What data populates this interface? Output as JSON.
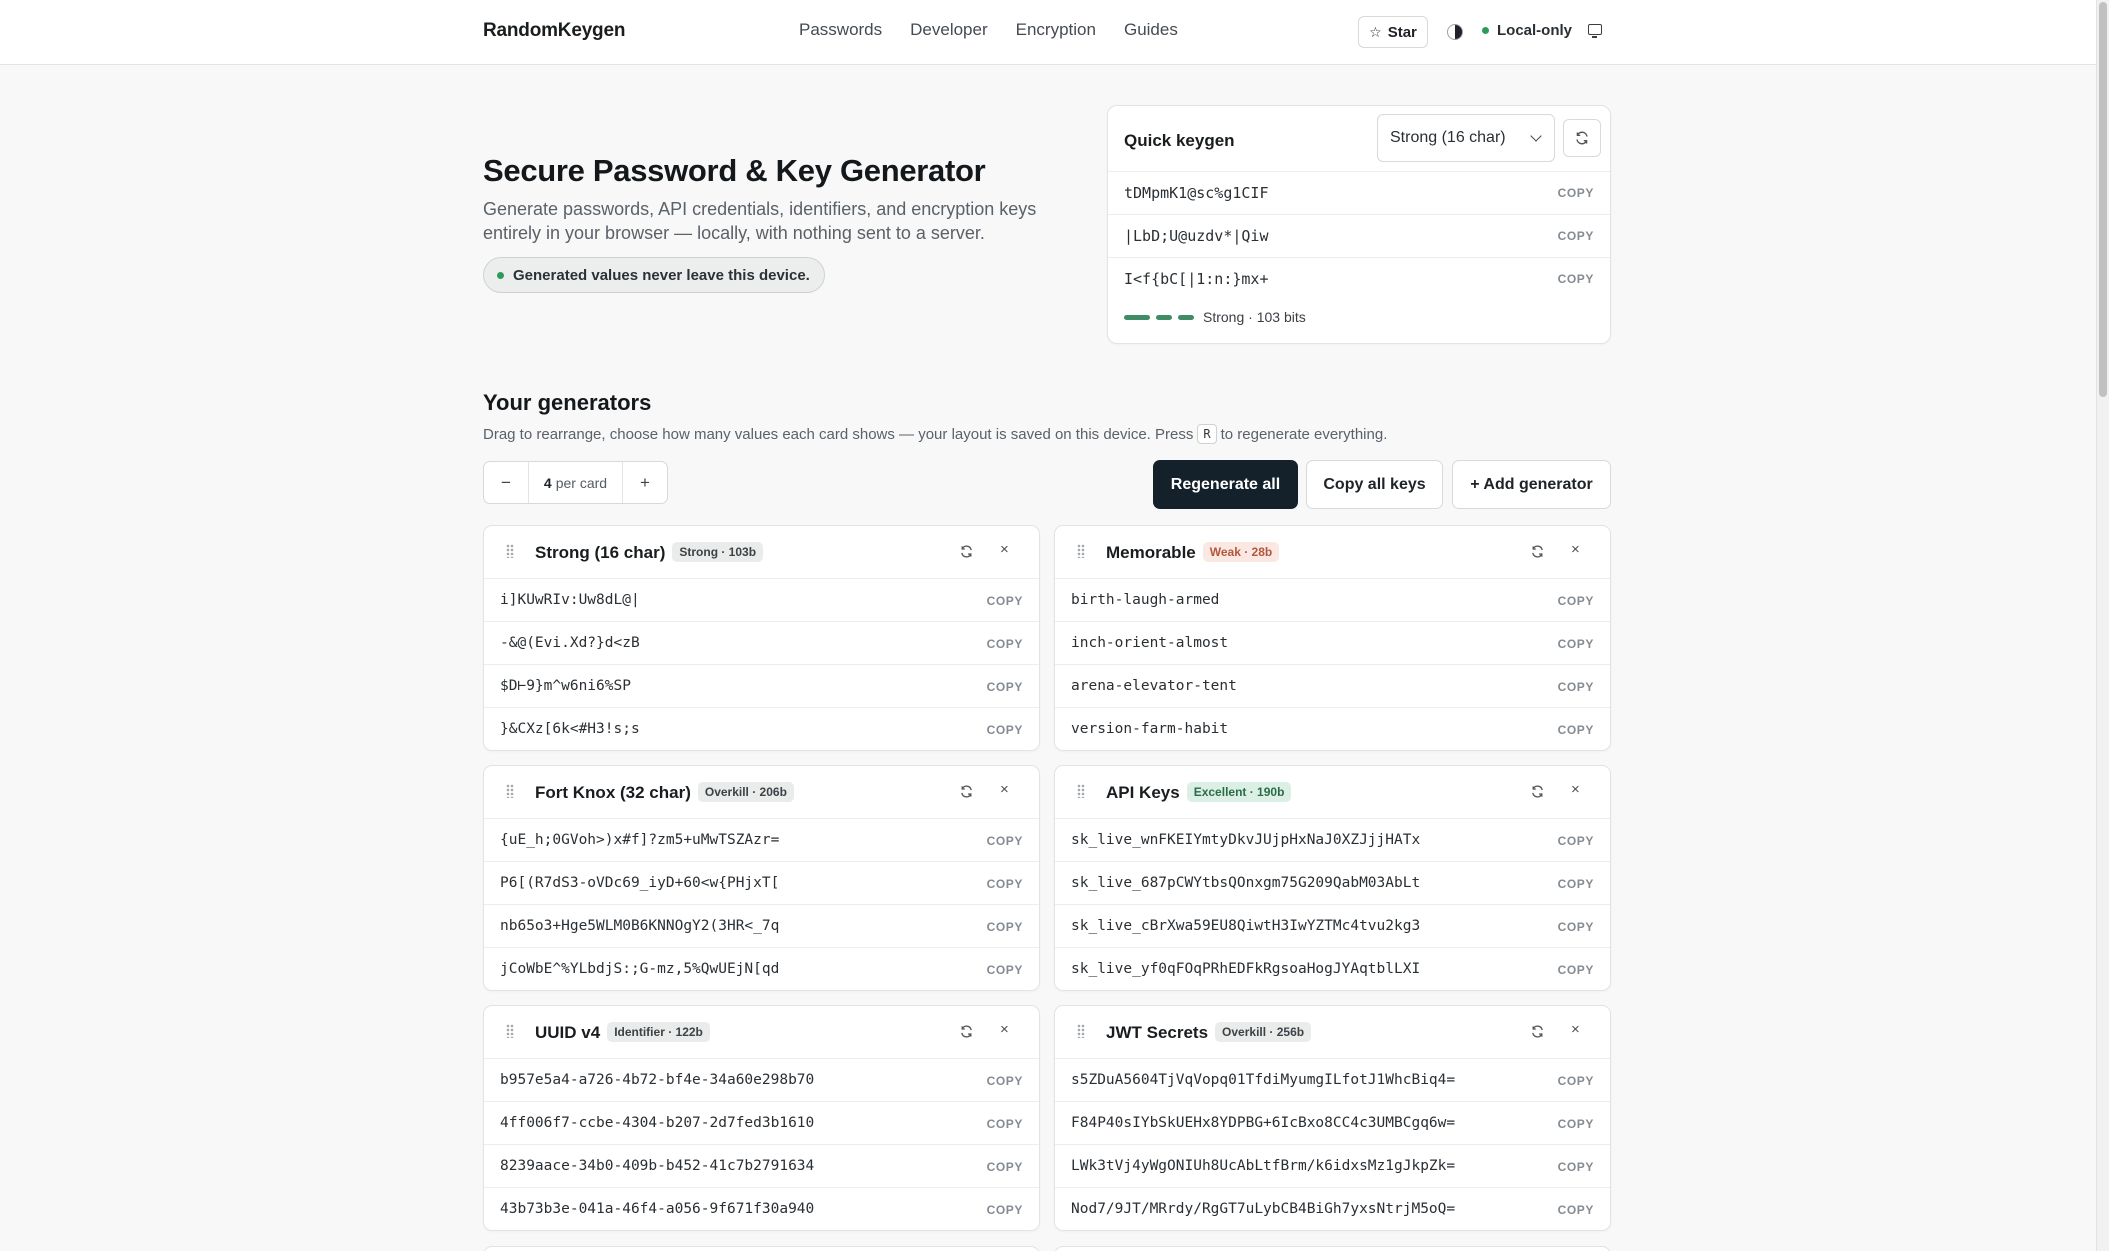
{
  "header": {
    "brand": "RandomKeygen",
    "nav": [
      "Passwords",
      "Developer",
      "Encryption",
      "Guides"
    ],
    "star_label": "Star",
    "local_label": "Local-only"
  },
  "hero": {
    "title": "Secure Password & Key Generator",
    "subtitle": "Generate passwords, API credentials, identifiers, and encryption keys entirely in your browser — locally, with nothing sent to a server.",
    "pill": "Generated values never leave this device."
  },
  "quick": {
    "title": "Quick keygen",
    "selected_preset": "Strong (16 char)",
    "values": [
      "tDMpmK1@sc%g1CIF",
      "|LbD;U@uzdv*|Qiw",
      "I<f{bC[|1:n:}mx+"
    ],
    "copy_label": "COPY",
    "strength_label": "Strong · 103 bits",
    "strength_color": "#3f8c66"
  },
  "generators": {
    "title": "Your generators",
    "subtitle_before": "Drag to rearrange, choose how many values each card shows — your layout is saved on this device. Press",
    "shortcut_key": "R",
    "subtitle_after": "to regenerate everything.",
    "per_card_count": "4",
    "per_card_label": "per card",
    "minus": "−",
    "plus": "+",
    "regenerate_all": "Regenerate all",
    "copy_all": "Copy all keys",
    "add_generator": "+ Add generator",
    "cards": [
      {
        "title": "Strong (16 char)",
        "badge": "Strong · 103b",
        "values": [
          "i]KUwRIv:Uw8dL@|",
          "-&@(Evi.Xd?}d<zB",
          "$D⊢9}m^w6ni6%SP",
          "}&CXz[6k<#H3!s;s"
        ]
      },
      {
        "title": "Memorable",
        "badge": "Weak · 28b",
        "values": [
          "birth-laugh-armed",
          "inch-orient-almost",
          "arena-elevator-tent",
          "version-farm-habit"
        ]
      },
      {
        "title": "Fort Knox (32 char)",
        "badge": "Overkill · 206b",
        "values": [
          "{uE_h;0GVoh>)x#f]?zm5+uMwTSZAzr=",
          "P6[(R7dS3-oVDc69_iyD+60<w{PHjxT[",
          "nb65o3+Hge5WLM0B6KNNOgY2(3HR<_7q",
          "jCoWbE^%YLbdjS:;G-mz,5%QwUEjN[qd"
        ]
      },
      {
        "title": "API Keys",
        "badge": "Excellent · 190b",
        "values": [
          "sk_live_wnFKEIYmtyDkvJUjpHxNaJ0XZJjjHATx",
          "sk_live_687pCWYtbsQOnxgm75G209QabM03AbLt",
          "sk_live_cBrXwa59EU8QiwtH3IwYZTMc4tvu2kg3",
          "sk_live_yf0qFOqPRhEDFkRgsoaHogJYAqtblLXI"
        ]
      },
      {
        "title": "UUID v4",
        "badge": "Identifier · 122b",
        "values": [
          "b957e5a4-a726-4b72-bf4e-34a60e298b70",
          "4ff006f7-ccbe-4304-b207-2d7fed3b1610",
          "8239aace-34b0-409b-b452-41c7b2791634",
          "43b73b3e-041a-46f4-a056-9f671f30a940"
        ]
      },
      {
        "title": "JWT Secrets",
        "badge": "Overkill · 256b",
        "values": [
          "s5ZDuA5604TjVqVopq01TfdiMyumgILfotJ1WhcBiq4=",
          "F84P40sIYbSkUEHx8YDPBG+6IcBxo8CC4c3UMBCgq6w=",
          "LWk3tVj4yWgONIUh8UcAbLtfBrm/k6idxsMz1gJkpZk=",
          "Nod7/9JT/MRrdy/RgGT7uLybCB4BiGh7yxsNtrjM5oQ="
        ]
      }
    ]
  }
}
